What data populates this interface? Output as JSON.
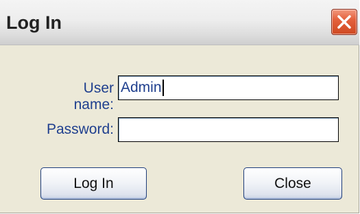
{
  "dialog": {
    "title": "Log In",
    "close_icon": "close-icon"
  },
  "form": {
    "username_label": "User name:",
    "username_value": "Admin",
    "password_label": "Password:",
    "password_value": ""
  },
  "buttons": {
    "login_label": "Log In",
    "close_label": "Close"
  },
  "colors": {
    "label_text": "#1f3f8e",
    "dialog_bg": "#ece9d8",
    "close_button": "#d95a36"
  }
}
